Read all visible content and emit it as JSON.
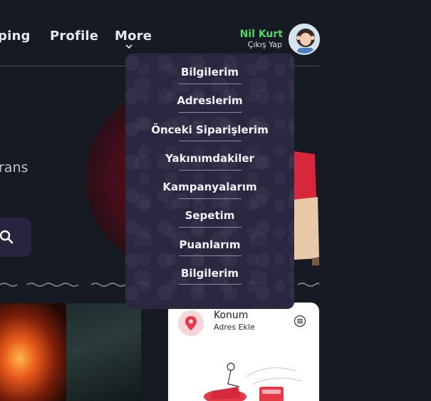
{
  "nav": {
    "items": [
      {
        "label": "ping"
      },
      {
        "label": "Profile"
      },
      {
        "label": "More"
      }
    ]
  },
  "user": {
    "name": "Nil Kurt",
    "logout_label": "Çıkış Yap"
  },
  "hero": {
    "partial_text": "rans"
  },
  "dropdown": {
    "items": [
      {
        "label": "Bilgilerim"
      },
      {
        "label": "Adreslerim"
      },
      {
        "label": "Önceki Siparişlerim"
      },
      {
        "label": "Yakınımdakiler"
      },
      {
        "label": "Kampanyalarım"
      },
      {
        "label": "Sepetim"
      },
      {
        "label": "Puanlarım"
      },
      {
        "label": "Bilgilerim"
      }
    ]
  },
  "location_card": {
    "title": "Konum",
    "subtitle": "Adres Ekle"
  },
  "icons": {
    "more": "chevron-down-icon",
    "search": "search-icon",
    "location": "location-pin-icon",
    "menu": "menu-icon"
  },
  "colors": {
    "background": "#161a22",
    "dropdown": "#2c2741",
    "user_name": "#52d468",
    "pin": "#e63946"
  }
}
